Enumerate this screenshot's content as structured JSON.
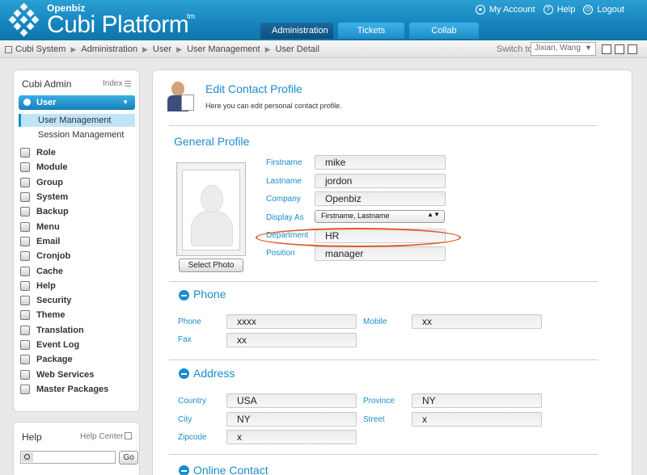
{
  "header": {
    "brand_small": "Openbiz",
    "brand": "Cubi Platform",
    "brand_tm": "tm",
    "links": [
      "My Account",
      "Help",
      "Logout"
    ],
    "tabs": [
      "Administration",
      "Tickets",
      "Collab"
    ],
    "active_tab": "Administration",
    "accent_color": "#1a8ccc"
  },
  "breadcrumb": {
    "items": [
      "Cubi System",
      "Administration",
      "User",
      "User Management",
      "User Detail"
    ],
    "separator": "▶",
    "switch_label": "Switch to",
    "switch_value": "Jixian, Wang"
  },
  "sidebar": {
    "title": "Cubi Admin",
    "index_label": "Index",
    "active_group": "User",
    "sub_items": [
      "User Management",
      "Session Management"
    ],
    "active_sub": "User Management",
    "items": [
      "Role",
      "Module",
      "Group",
      "System",
      "Backup",
      "Menu",
      "Email",
      "Cronjob",
      "Cache",
      "Help",
      "Security",
      "Theme",
      "Translation",
      "Event Log",
      "Package",
      "Web Services",
      "Master Packages"
    ]
  },
  "help": {
    "title": "Help",
    "center_label": "Help Center",
    "search_value": "",
    "go_label": "Go"
  },
  "main": {
    "title": "Edit Contact Profile",
    "description": "Here you can edit personal contact profile.",
    "sections": {
      "general": "General Profile",
      "phone": "Phone",
      "address": "Address",
      "online": "Online Contact"
    },
    "select_photo": "Select Photo",
    "general": {
      "firstname_label": "Firstname",
      "firstname": "mike",
      "lastname_label": "Lastname",
      "lastname": "jordon",
      "company_label": "Company",
      "company": "Openbiz",
      "display_as_label": "Display As",
      "display_as": "Firstname, Lastname",
      "department_label": "Department",
      "department": "HR",
      "position_label": "Position",
      "position": "manager"
    },
    "phone": {
      "phone_label": "Phone",
      "phone": "xxxx",
      "mobile_label": "Mobile",
      "mobile": "xx",
      "fax_label": "Fax",
      "fax": "xx"
    },
    "address": {
      "country_label": "Country",
      "country": "USA",
      "province_label": "Province",
      "province": "NY",
      "city_label": "City",
      "city": "NY",
      "street_label": "Street",
      "street": "x",
      "zipcode_label": "Zipcode",
      "zipcode": "x"
    },
    "highlight_color": "#e0582a"
  }
}
